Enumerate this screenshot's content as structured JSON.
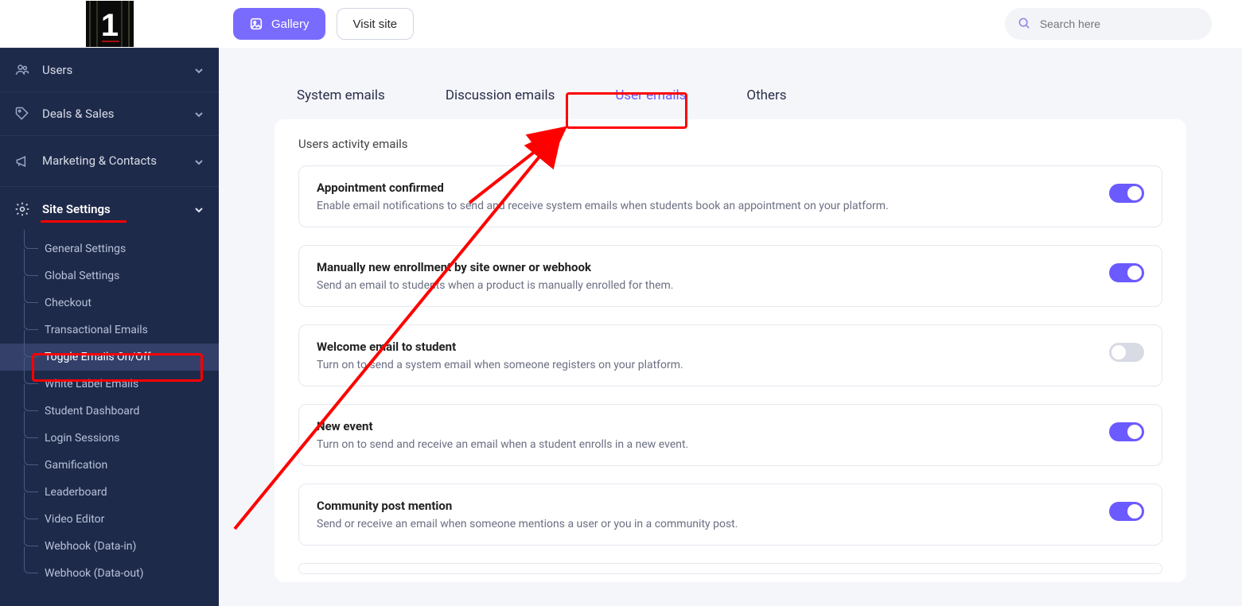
{
  "logo": {
    "text": "1"
  },
  "sidebar": {
    "items": [
      {
        "label": "Users"
      },
      {
        "label": "Deals & Sales"
      },
      {
        "label": "Marketing & Contacts"
      },
      {
        "label": "Site Settings"
      }
    ],
    "subitems": [
      {
        "label": "General Settings"
      },
      {
        "label": "Global Settings"
      },
      {
        "label": "Checkout"
      },
      {
        "label": "Transactional Emails"
      },
      {
        "label": "Toggle Emails On/Off"
      },
      {
        "label": "White Label Emails"
      },
      {
        "label": "Student Dashboard"
      },
      {
        "label": "Login Sessions"
      },
      {
        "label": "Gamification"
      },
      {
        "label": "Leaderboard"
      },
      {
        "label": "Video Editor"
      },
      {
        "label": "Webhook (Data-in)"
      },
      {
        "label": "Webhook (Data-out)"
      }
    ]
  },
  "topbar": {
    "gallery": "Gallery",
    "visit": "Visit site",
    "search_placeholder": "Search here"
  },
  "tabs": [
    {
      "label": "System emails"
    },
    {
      "label": "Discussion emails"
    },
    {
      "label": "User emails"
    },
    {
      "label": "Others"
    }
  ],
  "section_title": "Users activity emails",
  "cards": [
    {
      "title": "Appointment confirmed",
      "desc": "Enable email notifications to send and receive system emails when students book an appointment on your platform.",
      "on": true
    },
    {
      "title": "Manually new enrollment by site owner or webhook",
      "desc": "Send an email to students when a product is manually enrolled for them.",
      "on": true
    },
    {
      "title": "Welcome email to student",
      "desc": "Turn on to send a system email when someone registers on your platform.",
      "on": false
    },
    {
      "title": "New event",
      "desc": "Turn on to send and receive an email when a student enrolls in a new event.",
      "on": true
    },
    {
      "title": "Community post mention",
      "desc": "Send or receive an email when someone mentions a user or you in a community post.",
      "on": true
    }
  ]
}
